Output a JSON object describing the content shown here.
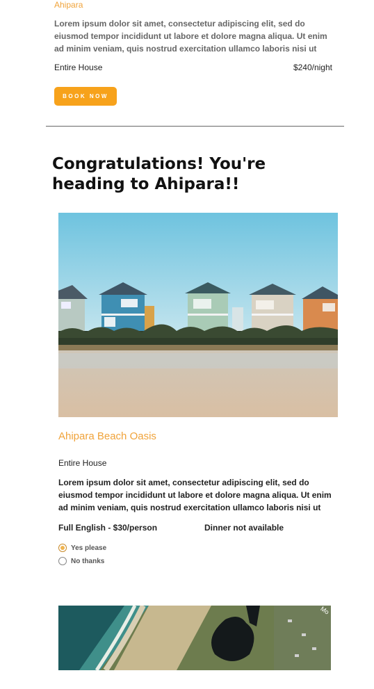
{
  "previous_listing": {
    "location": "Ahipara",
    "description": "Lorem ipsum dolor sit amet, consectetur adipiscing elit, sed do eiusmod tempor incididunt ut labore et dolore magna aliqua. Ut enim ad minim veniam, quis nostrud exercitation ullamco laboris nisi ut",
    "type": "Entire House",
    "price": "$240/night",
    "book_label": "BOOK NOW"
  },
  "confirmation": {
    "heading": "Congratulations! You're heading to Ahipara!!"
  },
  "property": {
    "name": "Ahipara Beach Oasis",
    "type": "Entire House",
    "description": "Lorem ipsum dolor sit amet, consectetur adipiscing elit, sed do eiusmod tempor incididunt ut labore et dolore magna aliqua. Ut enim ad minim veniam, quis nostrud exercitation ullamco laboris nisi ut",
    "breakfast": "Full English - $30/person",
    "dinner": "Dinner not available",
    "options": [
      {
        "label": "Yes please",
        "selected": true
      },
      {
        "label": "No thanks",
        "selected": false
      }
    ]
  },
  "map": {
    "corner_text": "Mo"
  },
  "colors": {
    "accent": "#f0a33a",
    "button": "#f7a21b"
  }
}
